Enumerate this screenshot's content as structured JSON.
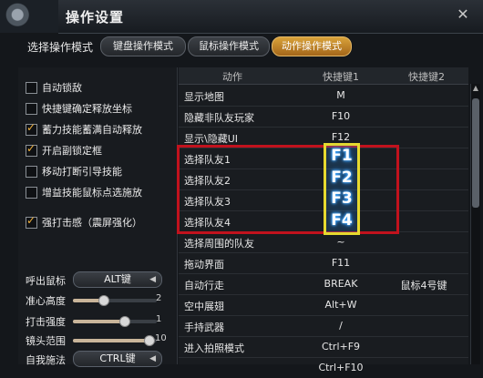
{
  "window": {
    "title": "操作设置"
  },
  "mode": {
    "label": "选择操作模式",
    "tabs": [
      {
        "label": "键盘操作模式",
        "active": false
      },
      {
        "label": "鼠标操作模式",
        "active": false
      },
      {
        "label": "动作操作模式",
        "active": true
      }
    ]
  },
  "options": [
    {
      "label": "自动锁敌",
      "checked": false
    },
    {
      "label": "快捷键确定释放坐标",
      "checked": false
    },
    {
      "label": "蓄力技能蓄满自动释放",
      "checked": true
    },
    {
      "label": "开启副锁定框",
      "checked": true
    },
    {
      "label": "移动打断引导技能",
      "checked": false
    },
    {
      "label": "增益技能鼠标点选施放",
      "checked": false
    },
    {
      "label": "强打击感（震屏强化）",
      "checked": true
    }
  ],
  "controls": {
    "call_mouse": {
      "label": "呼出鼠标",
      "value": "ALT键"
    },
    "crosshair_height": {
      "label": "准心高度",
      "value": "2",
      "level": 0.35
    },
    "hit_strength": {
      "label": "打击强度",
      "value": "1",
      "level": 0.6
    },
    "camera_range": {
      "label": "镜头范围",
      "value": "10",
      "level": 0.9
    },
    "self_cast": {
      "label": "自我施法",
      "value": "CTRL键"
    }
  },
  "table": {
    "headers": {
      "action": "动作",
      "key1": "快捷键1",
      "key2": "快捷键2"
    },
    "rows": [
      {
        "action": "显示地图",
        "key1": "M",
        "key2": ""
      },
      {
        "action": "隐藏非队友玩家",
        "key1": "F10",
        "key2": ""
      },
      {
        "action": "显示\\隐藏UI",
        "key1": "F12",
        "key2": ""
      },
      {
        "action": "选择队友1",
        "key1": "",
        "key2": ""
      },
      {
        "action": "选择队友2",
        "key1": "",
        "key2": ""
      },
      {
        "action": "选择队友3",
        "key1": "",
        "key2": ""
      },
      {
        "action": "选择队友4",
        "key1": "",
        "key2": ""
      },
      {
        "action": "选择周围的队友",
        "key1": "~",
        "key2": ""
      },
      {
        "action": "拖动界面",
        "key1": "F11",
        "key2": ""
      },
      {
        "action": "自动行走",
        "key1": "BREAK",
        "key2": "鼠标4号键"
      },
      {
        "action": "空中展翅",
        "key1": "Alt+W",
        "key2": ""
      },
      {
        "action": "手持武器",
        "key1": "/",
        "key2": ""
      },
      {
        "action": "进入拍照模式",
        "key1": "Ctrl+F9",
        "key2": ""
      },
      {
        "action": "",
        "key1": "Ctrl+F10",
        "key2": ""
      }
    ],
    "highlight_keys": [
      "F1",
      "F2",
      "F3",
      "F4"
    ]
  },
  "colors": {
    "accent": "#d9a23a",
    "highlight_red": "#c1121d",
    "highlight_yellow": "#e6d92f"
  }
}
